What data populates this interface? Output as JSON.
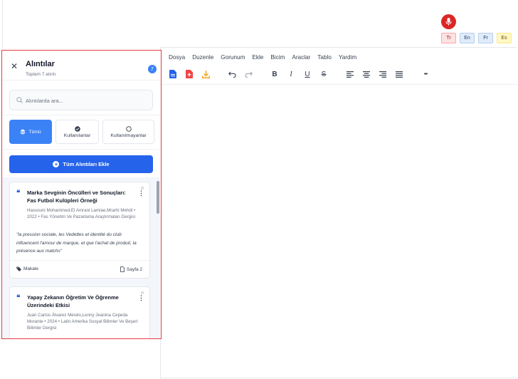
{
  "voice": {
    "mic_icon": "microphone-icon",
    "mic_color": "#dc2626"
  },
  "languages": [
    "Tr",
    "En",
    "Fr",
    "Es"
  ],
  "editor": {
    "menu": [
      "Dosya",
      "Duzenle",
      "Gorunum",
      "Ekle",
      "Bicim",
      "Araclar",
      "Tablo",
      "Yardim"
    ],
    "toolbar_icons": [
      "word-export-icon",
      "pdf-export-icon",
      "download-icon",
      "undo-icon",
      "redo-icon",
      "bold-icon",
      "italic-icon",
      "underline-icon",
      "strikethrough-icon",
      "align-left-icon",
      "align-center-icon",
      "align-right-icon",
      "align-justify-icon",
      "more-icon"
    ],
    "toolbar_glyphs": {
      "bold": "B",
      "italic": "I",
      "underline": "U",
      "strike": "S",
      "more": "•••"
    }
  },
  "panel": {
    "title": "Alıntılar",
    "subtitle": "Toplam 7 alıntı",
    "count": "7",
    "close_glyph": "✕",
    "search_placeholder": "Alıntılarda ara...",
    "filters": {
      "all": "Tümü",
      "used": "Kullanılanlar",
      "unused": "Kullanılmayanlar"
    },
    "add_all_label": "Tüm Alıntıları Ekle",
    "accent_color": "#3b82f6",
    "border_color": "#e53945"
  },
  "citations": [
    {
      "title": "Marka Sevginin Öncülleri ve Sonuçları: Fas Futbol Kulüpleri Örneği",
      "meta": "Hassouni Mohammed,El Amrani Lamiae,Mrarhi Mehdi • 2022 • Fas Yönetim Ve Pazarlama Araştırmaları Dergisi",
      "quote": "\"la pression sociale, les Vedettes et identité du club influencent l'amour de marque, et que l'achat de produit, la présence aux matchs\"",
      "type": "Makale",
      "page": "Sayfa 2"
    },
    {
      "title": "Yapay Zekanın Öğretim Ve Öğrenme Üzerindeki Etkisi",
      "meta": "Juan Carlos Álvarez Merelo,Lenny Jeanina Cepeda Morante • 2024 • Latin Amerika Sosyal Bilimler Ve Beşeri Bilimler Dergisi"
    }
  ],
  "glyphs": {
    "quote_mark": "❝",
    "menu": "⋮"
  }
}
